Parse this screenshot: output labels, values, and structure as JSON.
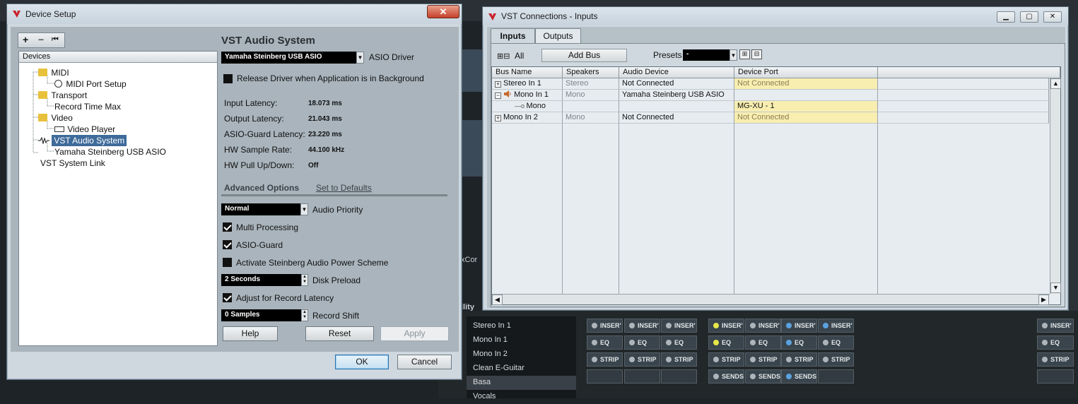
{
  "device_setup": {
    "title": "Device Setup",
    "close_glyph": "✕",
    "toolbar": {
      "add": "+",
      "remove": "−",
      "reset": "⏮"
    },
    "devices_header": "Devices",
    "tree": [
      {
        "label": "MIDI",
        "level": 0,
        "icon": "folder-icon"
      },
      {
        "label": "MIDI Port Setup",
        "level": 1,
        "icon": "midi-port-icon"
      },
      {
        "label": "Transport",
        "level": 0,
        "icon": "folder-icon"
      },
      {
        "label": "Record Time Max",
        "level": 1,
        "icon": ""
      },
      {
        "label": "Video",
        "level": 0,
        "icon": "folder-icon"
      },
      {
        "label": "Video Player",
        "level": 1,
        "icon": "video-player-icon"
      },
      {
        "label": "VST Audio System",
        "level": 0,
        "icon": "audio-system-icon",
        "selected": true
      },
      {
        "label": "Yamaha Steinberg USB ASIO",
        "level": 1,
        "icon": ""
      },
      {
        "label": "VST System Link",
        "level": 0,
        "icon": ""
      }
    ],
    "section_title": "VST Audio System",
    "asio_driver": {
      "value": "Yamaha Steinberg USB ASIO",
      "label": "ASIO Driver"
    },
    "release_driver": {
      "label": "Release Driver when Application is in Background",
      "checked": false
    },
    "latencies": [
      {
        "label": "Input Latency:",
        "value": "18.073 ms"
      },
      {
        "label": "Output Latency:",
        "value": "21.043 ms"
      },
      {
        "label": "ASIO-Guard Latency:",
        "value": "23.220 ms"
      },
      {
        "label": "HW Sample Rate:",
        "value": "44.100 kHz"
      },
      {
        "label": "HW Pull Up/Down:",
        "value": "Off"
      }
    ],
    "advanced_options": "Advanced Options",
    "set_to_defaults": "Set to Defaults",
    "audio_priority": {
      "value": "Normal",
      "label": "Audio Priority"
    },
    "multi_processing": {
      "label": "Multi Processing",
      "checked": true
    },
    "asio_guard": {
      "label": "ASIO-Guard",
      "checked": true
    },
    "power_scheme": {
      "label": "Activate Steinberg Audio Power Scheme",
      "checked": false
    },
    "disk_preload": {
      "value": "2 Seconds",
      "label": "Disk Preload"
    },
    "adjust_latency": {
      "label": "Adjust for Record Latency",
      "checked": true
    },
    "record_shift": {
      "value": "0 Samples",
      "label": "Record Shift"
    },
    "buttons": {
      "help": "Help",
      "reset": "Reset",
      "apply": "Apply",
      "ok": "OK",
      "cancel": "Cancel"
    }
  },
  "vst_connections": {
    "title": "VST Connections - Inputs",
    "tabs": [
      {
        "label": "Inputs",
        "active": true
      },
      {
        "label": "Outputs",
        "active": false
      }
    ],
    "all_label": "All",
    "add_bus": "Add Bus",
    "presets_label": "Presets",
    "presets_value": "-",
    "columns": [
      "Bus Name",
      "Speakers",
      "Audio Device",
      "Device Port"
    ],
    "rows": [
      {
        "bus": "Stereo In 1",
        "expander": "+",
        "speakers": "Stereo",
        "device": "Not Connected",
        "port": "Not Connected",
        "port_nc": true
      },
      {
        "bus": "Mono In 1",
        "expander": "−",
        "speakers": "Mono",
        "device": "Yamaha Steinberg USB ASIO",
        "port": "",
        "port_nc": false,
        "speaker_icon": true
      },
      {
        "bus": "Mono",
        "expander": "",
        "speakers": "",
        "device": "",
        "port": "MG-XU - 1",
        "port_nc": false,
        "child": true
      },
      {
        "bus": "Mono In 2",
        "expander": "+",
        "speakers": "Mono",
        "device": "Not Connected",
        "port": "Not Connected",
        "port_nc": true
      }
    ]
  },
  "mixer": {
    "tracks": [
      "Stereo In 1",
      "Mono In 1",
      "Mono In 2",
      "Clean E-Guitar",
      "Basa",
      "Vocals"
    ],
    "selected_track": "Basa",
    "partial_labels": {
      "xcon": "xCor",
      "ility": "ility"
    },
    "insert_label": "INSER'",
    "eq_label": "EQ",
    "strip_label": "STRIP",
    "sends_label": "SENDS"
  }
}
